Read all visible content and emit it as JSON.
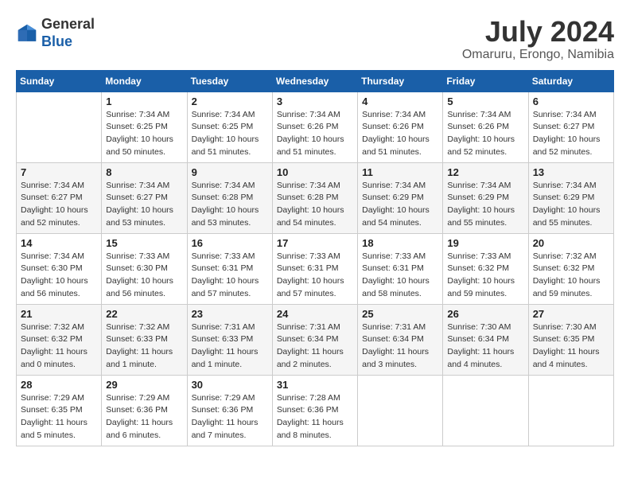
{
  "header": {
    "logo_general": "General",
    "logo_blue": "Blue",
    "title": "July 2024",
    "location": "Omaruru, Erongo, Namibia"
  },
  "columns": [
    "Sunday",
    "Monday",
    "Tuesday",
    "Wednesday",
    "Thursday",
    "Friday",
    "Saturday"
  ],
  "weeks": [
    [
      {
        "day": "",
        "detail": ""
      },
      {
        "day": "1",
        "detail": "Sunrise: 7:34 AM\nSunset: 6:25 PM\nDaylight: 10 hours\nand 50 minutes."
      },
      {
        "day": "2",
        "detail": "Sunrise: 7:34 AM\nSunset: 6:25 PM\nDaylight: 10 hours\nand 51 minutes."
      },
      {
        "day": "3",
        "detail": "Sunrise: 7:34 AM\nSunset: 6:26 PM\nDaylight: 10 hours\nand 51 minutes."
      },
      {
        "day": "4",
        "detail": "Sunrise: 7:34 AM\nSunset: 6:26 PM\nDaylight: 10 hours\nand 51 minutes."
      },
      {
        "day": "5",
        "detail": "Sunrise: 7:34 AM\nSunset: 6:26 PM\nDaylight: 10 hours\nand 52 minutes."
      },
      {
        "day": "6",
        "detail": "Sunrise: 7:34 AM\nSunset: 6:27 PM\nDaylight: 10 hours\nand 52 minutes."
      }
    ],
    [
      {
        "day": "7",
        "detail": "Sunrise: 7:34 AM\nSunset: 6:27 PM\nDaylight: 10 hours\nand 52 minutes."
      },
      {
        "day": "8",
        "detail": "Sunrise: 7:34 AM\nSunset: 6:27 PM\nDaylight: 10 hours\nand 53 minutes."
      },
      {
        "day": "9",
        "detail": "Sunrise: 7:34 AM\nSunset: 6:28 PM\nDaylight: 10 hours\nand 53 minutes."
      },
      {
        "day": "10",
        "detail": "Sunrise: 7:34 AM\nSunset: 6:28 PM\nDaylight: 10 hours\nand 54 minutes."
      },
      {
        "day": "11",
        "detail": "Sunrise: 7:34 AM\nSunset: 6:29 PM\nDaylight: 10 hours\nand 54 minutes."
      },
      {
        "day": "12",
        "detail": "Sunrise: 7:34 AM\nSunset: 6:29 PM\nDaylight: 10 hours\nand 55 minutes."
      },
      {
        "day": "13",
        "detail": "Sunrise: 7:34 AM\nSunset: 6:29 PM\nDaylight: 10 hours\nand 55 minutes."
      }
    ],
    [
      {
        "day": "14",
        "detail": "Sunrise: 7:34 AM\nSunset: 6:30 PM\nDaylight: 10 hours\nand 56 minutes."
      },
      {
        "day": "15",
        "detail": "Sunrise: 7:33 AM\nSunset: 6:30 PM\nDaylight: 10 hours\nand 56 minutes."
      },
      {
        "day": "16",
        "detail": "Sunrise: 7:33 AM\nSunset: 6:31 PM\nDaylight: 10 hours\nand 57 minutes."
      },
      {
        "day": "17",
        "detail": "Sunrise: 7:33 AM\nSunset: 6:31 PM\nDaylight: 10 hours\nand 57 minutes."
      },
      {
        "day": "18",
        "detail": "Sunrise: 7:33 AM\nSunset: 6:31 PM\nDaylight: 10 hours\nand 58 minutes."
      },
      {
        "day": "19",
        "detail": "Sunrise: 7:33 AM\nSunset: 6:32 PM\nDaylight: 10 hours\nand 59 minutes."
      },
      {
        "day": "20",
        "detail": "Sunrise: 7:32 AM\nSunset: 6:32 PM\nDaylight: 10 hours\nand 59 minutes."
      }
    ],
    [
      {
        "day": "21",
        "detail": "Sunrise: 7:32 AM\nSunset: 6:32 PM\nDaylight: 11 hours\nand 0 minutes."
      },
      {
        "day": "22",
        "detail": "Sunrise: 7:32 AM\nSunset: 6:33 PM\nDaylight: 11 hours\nand 1 minute."
      },
      {
        "day": "23",
        "detail": "Sunrise: 7:31 AM\nSunset: 6:33 PM\nDaylight: 11 hours\nand 1 minute."
      },
      {
        "day": "24",
        "detail": "Sunrise: 7:31 AM\nSunset: 6:34 PM\nDaylight: 11 hours\nand 2 minutes."
      },
      {
        "day": "25",
        "detail": "Sunrise: 7:31 AM\nSunset: 6:34 PM\nDaylight: 11 hours\nand 3 minutes."
      },
      {
        "day": "26",
        "detail": "Sunrise: 7:30 AM\nSunset: 6:34 PM\nDaylight: 11 hours\nand 4 minutes."
      },
      {
        "day": "27",
        "detail": "Sunrise: 7:30 AM\nSunset: 6:35 PM\nDaylight: 11 hours\nand 4 minutes."
      }
    ],
    [
      {
        "day": "28",
        "detail": "Sunrise: 7:29 AM\nSunset: 6:35 PM\nDaylight: 11 hours\nand 5 minutes."
      },
      {
        "day": "29",
        "detail": "Sunrise: 7:29 AM\nSunset: 6:36 PM\nDaylight: 11 hours\nand 6 minutes."
      },
      {
        "day": "30",
        "detail": "Sunrise: 7:29 AM\nSunset: 6:36 PM\nDaylight: 11 hours\nand 7 minutes."
      },
      {
        "day": "31",
        "detail": "Sunrise: 7:28 AM\nSunset: 6:36 PM\nDaylight: 11 hours\nand 8 minutes."
      },
      {
        "day": "",
        "detail": ""
      },
      {
        "day": "",
        "detail": ""
      },
      {
        "day": "",
        "detail": ""
      }
    ]
  ]
}
